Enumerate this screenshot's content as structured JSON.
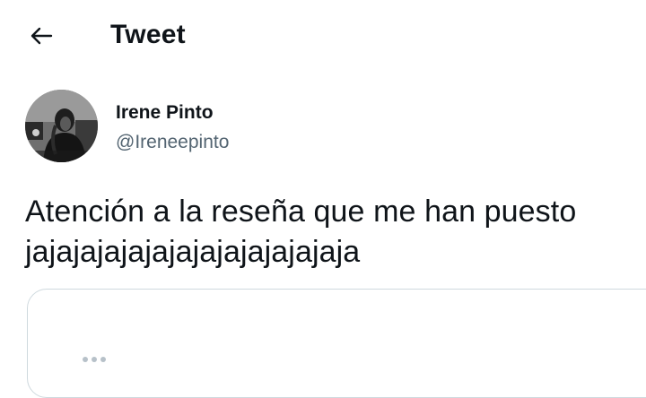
{
  "header": {
    "back_icon": "arrow-left-icon",
    "title": "Tweet"
  },
  "author": {
    "display_name": "Irene Pinto",
    "handle": "@Ireneepinto",
    "avatar_icon": "avatar-photo"
  },
  "tweet": {
    "text": "Atención a la reseña que me han puesto\njajajajajajajajajajajajajaja"
  },
  "colors": {
    "text_primary": "#0f1419",
    "text_secondary": "#536471",
    "border": "#cfd9de",
    "background": "#ffffff"
  }
}
